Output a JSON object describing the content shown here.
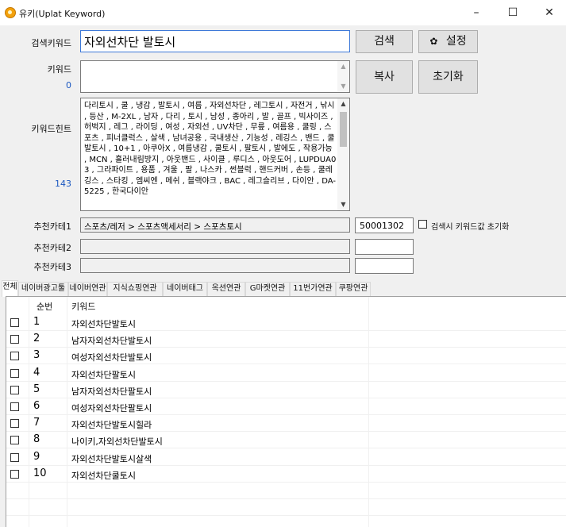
{
  "window": {
    "title": "유키(Uplat Keyword)",
    "controls": {
      "minimize": "–",
      "maximize": "☐",
      "close": "✕"
    }
  },
  "search": {
    "label": "검색키워드",
    "value": "자외선차단 발토시",
    "search_button": "검색",
    "settings_icon": "✿",
    "settings_label": "설정"
  },
  "keywords": {
    "label": "키워드",
    "count": "0",
    "value": "",
    "copy_button": "복사",
    "reset_button": "초기화"
  },
  "hints": {
    "label": "키워드힌트",
    "count": "143",
    "text": "다리토시 , 쿨 , 냉감 , 발토시 , 여름 , 자외선차단 , 레그토시 , 자전거 , 낚시 , 등산 , M-2XL , 남자 , 다리 , 토시 , 남성 , 종아리 , 발 , 골프 , 빅사이즈 , 허벅지 , 레그 , 라이딩 , 여성 , 자외선 , UV차단 , 무릎 , 여름용 , 쿨링 , 스포츠 , 피너클럭스 , 살색 , 남녀공용 , 국내생산 , 기능성 , 레깅스 , 밴드 , 쿨발토시 , 10+1 , 아쿠아X , 여름냉감 , 쿨토시 , 팔토시 , 발에도 , 작용가능 , MCN , 흘러내림방지 , 아웃밴드 , 사이클 , 루디스 , 아웃도어 , LUPDUA03 , 그라파이트 , 용품 , 겨울 , 팔 , 나스카 , 썬블럭 , 핸드커버 , 손등 , 쿨레깅스 , 스타킹 , 엠씨엔 , 메쉬 , 블랙야크 , BAC , 레그슬리브 , 다이안 , DA-5225 , 한국다이안"
  },
  "categories": [
    {
      "label": "추천카테1",
      "path": "스포츠/레저 > 스포츠액세서리 > 스포츠토시",
      "code": "50001302"
    },
    {
      "label": "추천카테2",
      "path": "",
      "code": ""
    },
    {
      "label": "추천카테3",
      "path": "",
      "code": ""
    }
  ],
  "reset_on_search_label": "검색시 키워드값 초기화",
  "tabs": [
    "전체",
    "네이버광고툴",
    "네이버연관",
    "지식쇼핑연관",
    "네이버태그",
    "옥션연관",
    "G마켓연관",
    "11번가연관",
    "쿠팡연관"
  ],
  "table": {
    "columns": [
      "순번",
      "키워드"
    ],
    "rows": [
      {
        "num": "1",
        "keyword": "자외선차단발토시"
      },
      {
        "num": "2",
        "keyword": "남자자외선차단발토시"
      },
      {
        "num": "3",
        "keyword": "여성자외선차단발토시"
      },
      {
        "num": "4",
        "keyword": "자외선차단팔토시"
      },
      {
        "num": "5",
        "keyword": "남자자외선차단팔토시"
      },
      {
        "num": "6",
        "keyword": "여성자외선차단팔토시"
      },
      {
        "num": "7",
        "keyword": "자외선차단발토시힐라"
      },
      {
        "num": "8",
        "keyword": "나이키,자외선차단발토시"
      },
      {
        "num": "9",
        "keyword": "자외선차단발토시살색"
      },
      {
        "num": "10",
        "keyword": "자외선차단쿨토시"
      }
    ]
  }
}
